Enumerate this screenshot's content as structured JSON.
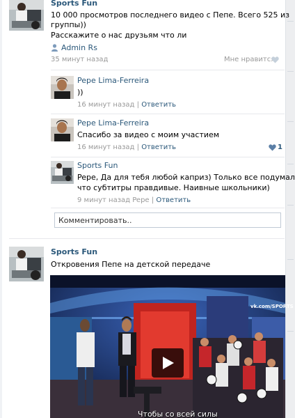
{
  "post1": {
    "author": "Sports Fun",
    "text_line1": "10 000 просмотров последнего видео с Пепе. Всего 525 из",
    "text_line2": "группы))",
    "text_line3": "Расскажите о нас друзьям что ли",
    "signed_by": "Admin Rs",
    "time": "35 минут назад",
    "like_label": "Мне нравится",
    "comments": [
      {
        "author": "Pepe Lima-Ferreira",
        "text": "))",
        "time": "16 минут назад",
        "reply": "Ответить"
      },
      {
        "author": "Pepe Lima-Ferreira",
        "text": "Спасибо за видео с моим участием",
        "time": "16 минут назад",
        "reply": "Ответить",
        "likes": "1"
      },
      {
        "author": "Sports Fun",
        "text_line1": "Pepe, Да для тебя любой каприз) Только все подумали",
        "text_line2": "что субтитры правдивые. Наивные школьники)",
        "time": "9 минут назад Pepe",
        "reply": "Ответить"
      }
    ],
    "comment_placeholder": "Комментировать.."
  },
  "post2": {
    "author": "Sports Fun",
    "text": "Откровения Пепе на детской передаче",
    "video_subtitle": "Чтобы со всей силы",
    "video_watermark": "vk.com/SPORTS FUN"
  },
  "colors": {
    "link": "#2b587a",
    "meta": "#999999",
    "divider": "#e7e8ec",
    "like_heart_active": "#5b7fa6",
    "like_heart_inactive": "#c5d0db"
  },
  "icons": {
    "author": "user-icon",
    "like": "heart-icon",
    "play": "play-icon"
  }
}
